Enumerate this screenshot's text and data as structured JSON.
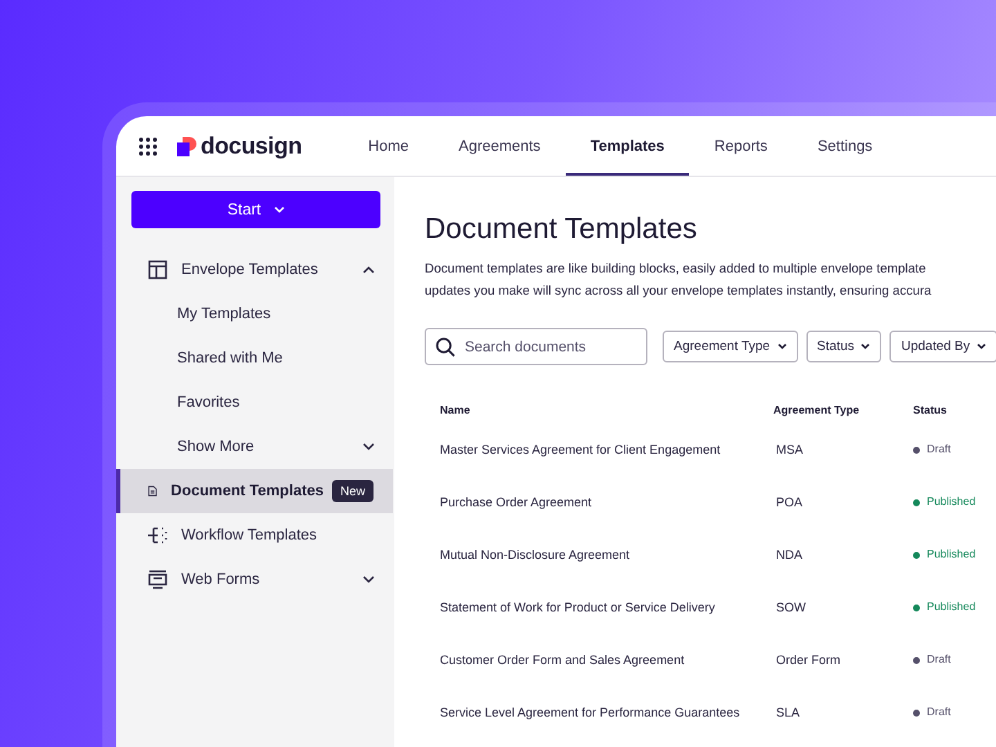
{
  "header": {
    "brand": "docusign",
    "tabs": [
      {
        "label": "Home",
        "selected": false
      },
      {
        "label": "Agreements",
        "selected": false
      },
      {
        "label": "Templates",
        "selected": true
      },
      {
        "label": "Reports",
        "selected": false
      },
      {
        "label": "Settings",
        "selected": false
      }
    ]
  },
  "sidebar": {
    "start_button": "Start",
    "items": [
      {
        "label": "Envelope Templates",
        "kind": "layout",
        "selected": false,
        "expanded": true,
        "children": [
          {
            "label": "My Templates",
            "selected": false
          },
          {
            "label": "Shared with Me",
            "selected": false
          },
          {
            "label": "Favorites",
            "selected": false
          },
          {
            "label": "Show More",
            "selected": false,
            "expanded": false
          }
        ]
      },
      {
        "label": "Document Templates",
        "kind": "document",
        "selected": true,
        "badge": "New"
      },
      {
        "label": "Workflow Templates",
        "kind": "workflow",
        "selected": false
      },
      {
        "label": "Web Forms",
        "kind": "form",
        "selected": false,
        "expanded": false
      }
    ]
  },
  "main": {
    "title": "Document Templates",
    "description": [
      "Document templates are like building blocks, easily added to multiple envelope template",
      "updates you make will sync across all your envelope templates instantly, ensuring accura"
    ],
    "search": {
      "placeholder": "Search documents"
    },
    "filters": [
      "Agreement Type",
      "Status",
      "Updated By"
    ],
    "table": {
      "columns": [
        "Name",
        "Agreement Type",
        "Status"
      ],
      "rows": [
        {
          "name": "Master Services Agreement for Client Engagement",
          "type": "MSA",
          "status": {
            "label": "Draft",
            "color": "#55506a"
          }
        },
        {
          "name": "Purchase Order Agreement",
          "type": "POA",
          "status": {
            "label": "Published",
            "color": "#14885a"
          }
        },
        {
          "name": "Mutual Non-Disclosure Agreement",
          "type": "NDA",
          "status": {
            "label": "Published",
            "color": "#14885a"
          }
        },
        {
          "name": "Statement of Work for Product or Service Delivery",
          "type": "SOW",
          "status": {
            "label": "Published",
            "color": "#14885a"
          }
        },
        {
          "name": "Customer Order Form and Sales Agreement",
          "type": "Order Form",
          "status": {
            "label": "Draft",
            "color": "#55506a"
          }
        },
        {
          "name": "Service Level Agreement for Performance Guarantees",
          "type": "SLA",
          "status": {
            "label": "Draft",
            "color": "#55506a"
          }
        }
      ]
    }
  }
}
